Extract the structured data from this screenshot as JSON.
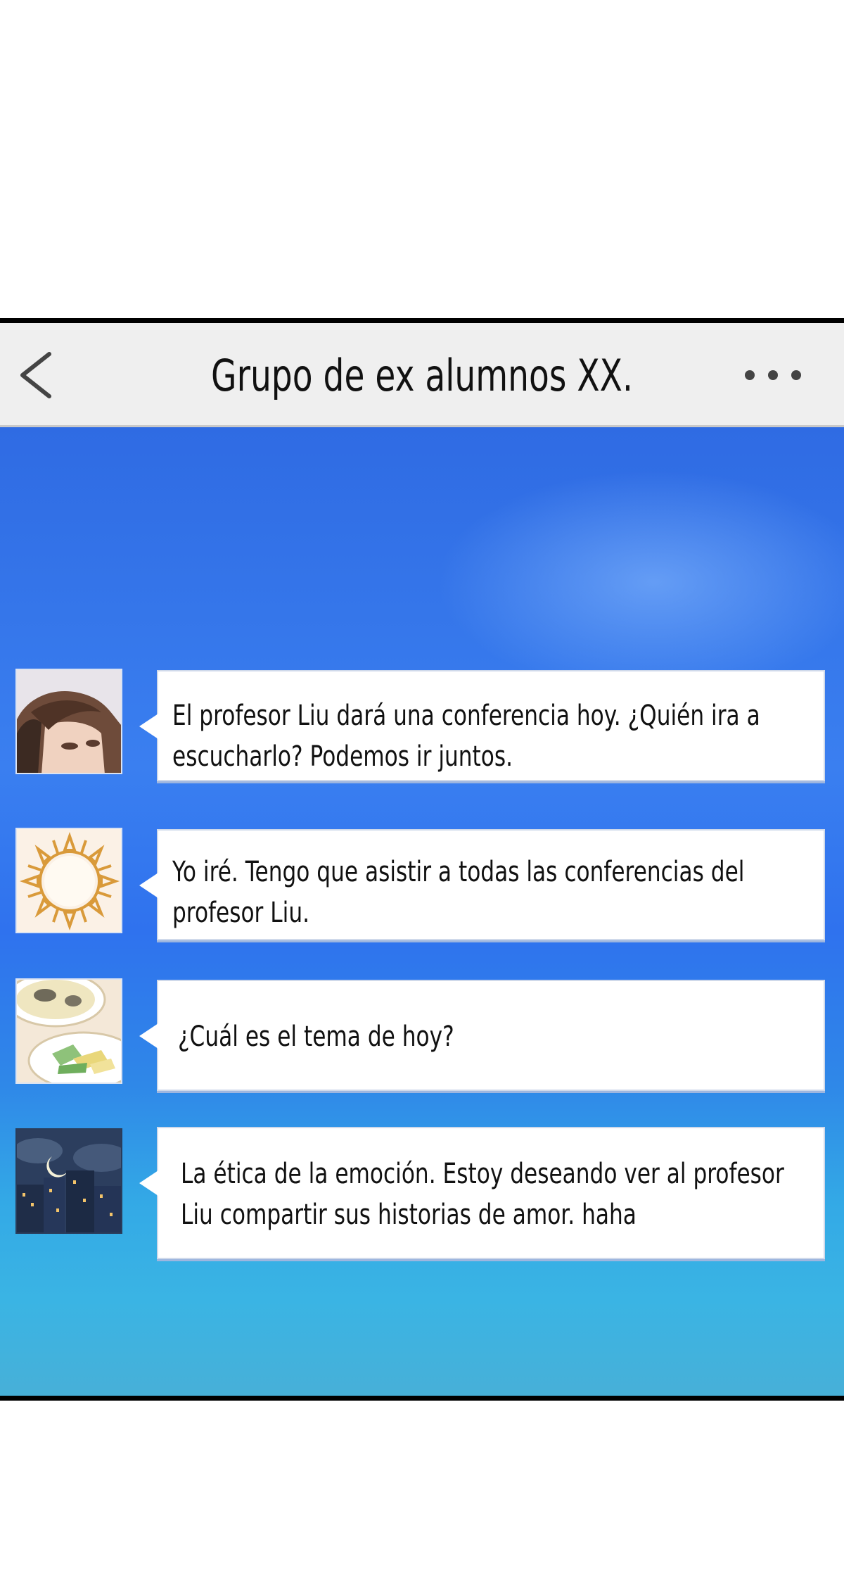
{
  "header": {
    "title": "Grupo de ex alumnos XX.",
    "back_icon": "chevron-left-icon",
    "more_icon": "more-dots-icon"
  },
  "messages": [
    {
      "avatar": "boy-avatar",
      "text": "El profesor Liu dará una conferencia hoy. ¿Quién ira a escucharlo? Podemos ir juntos."
    },
    {
      "avatar": "sun-avatar",
      "text": "Yo iré. Tengo que asistir a todas las conferencias del profesor Liu."
    },
    {
      "avatar": "food-avatar",
      "text": "¿Cuál es el tema de hoy?"
    },
    {
      "avatar": "night-city-avatar",
      "text": "La ética de la emoción. Estoy deseando ver al profesor Liu compartir sus historias de amor. haha"
    }
  ],
  "colors": {
    "header_bg": "#efefef",
    "chat_bg_top": "#2f6be3",
    "chat_bg_bottom": "#47b0d8",
    "bubble_bg": "#ffffff"
  }
}
